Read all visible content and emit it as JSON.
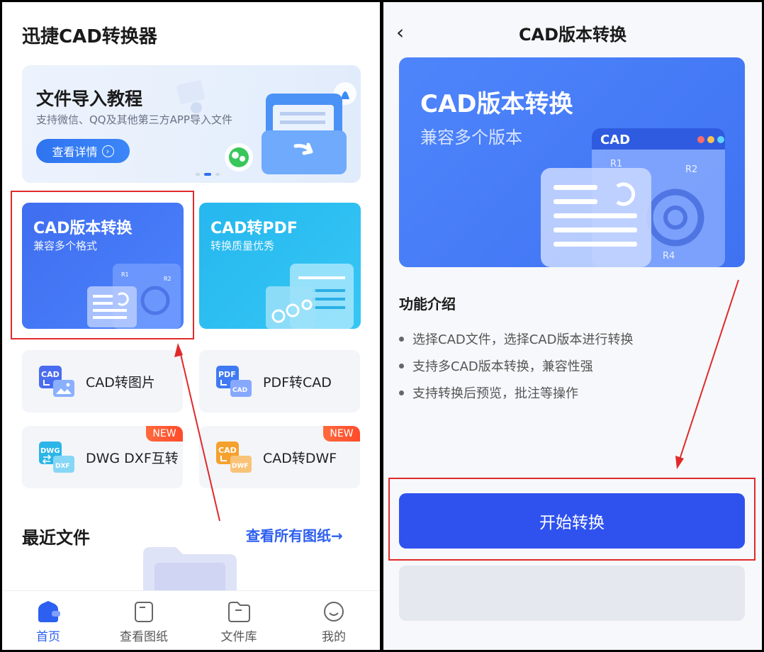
{
  "left": {
    "app_title": "迅捷CAD转换器",
    "banner": {
      "title": "文件导入教程",
      "subtitle": "支持微信、QQ及其他第三方APP导入文件",
      "button": "查看详情",
      "carousel_total": 3,
      "carousel_active": 2
    },
    "cards": {
      "cad_version": {
        "title": "CAD版本转换",
        "subtitle": "兼容多个格式"
      },
      "cad_pdf": {
        "title": "CAD转PDF",
        "subtitle": "转换质量优秀"
      }
    },
    "tools": [
      {
        "label": "CAD转图片",
        "icon_text_top": "CAD",
        "icon": "image-icon",
        "badge": ""
      },
      {
        "label": "PDF转CAD",
        "icon_text_top": "PDF",
        "icon_text_bottom": "CAD",
        "badge": ""
      },
      {
        "label": "DWG DXF互转",
        "icon_text_top": "DWG",
        "icon_text_bottom": "DXF",
        "badge": "NEW"
      },
      {
        "label": "CAD转DWF",
        "icon_text_top": "CAD",
        "icon_text_bottom": "DWF",
        "badge": "NEW"
      }
    ],
    "recent": {
      "title": "最近文件",
      "link": "查看所有图纸→"
    },
    "tabbar": [
      {
        "label": "首页",
        "active": true,
        "icon": "home-icon"
      },
      {
        "label": "查看图纸",
        "active": false,
        "icon": "drawing-icon"
      },
      {
        "label": "文件库",
        "active": false,
        "icon": "folder-icon"
      },
      {
        "label": "我的",
        "active": false,
        "icon": "profile-icon"
      }
    ]
  },
  "right": {
    "back_icon": "‹",
    "title": "CAD版本转换",
    "hero": {
      "title": "CAD版本转换",
      "subtitle": "兼容多个版本",
      "window_label": "CAD",
      "r1": "R1",
      "r2": "R2",
      "r4": "R4"
    },
    "features_title": "功能介绍",
    "features": [
      "选择CAD文件，选择CAD版本进行转换",
      "支持多CAD版本转换，兼容性强",
      "支持转换后预览，批注等操作"
    ],
    "start_button": "开始转换"
  },
  "colors": {
    "accent": "#2f52ee",
    "highlight": "#e02a2a",
    "badge": "#ff5533"
  }
}
